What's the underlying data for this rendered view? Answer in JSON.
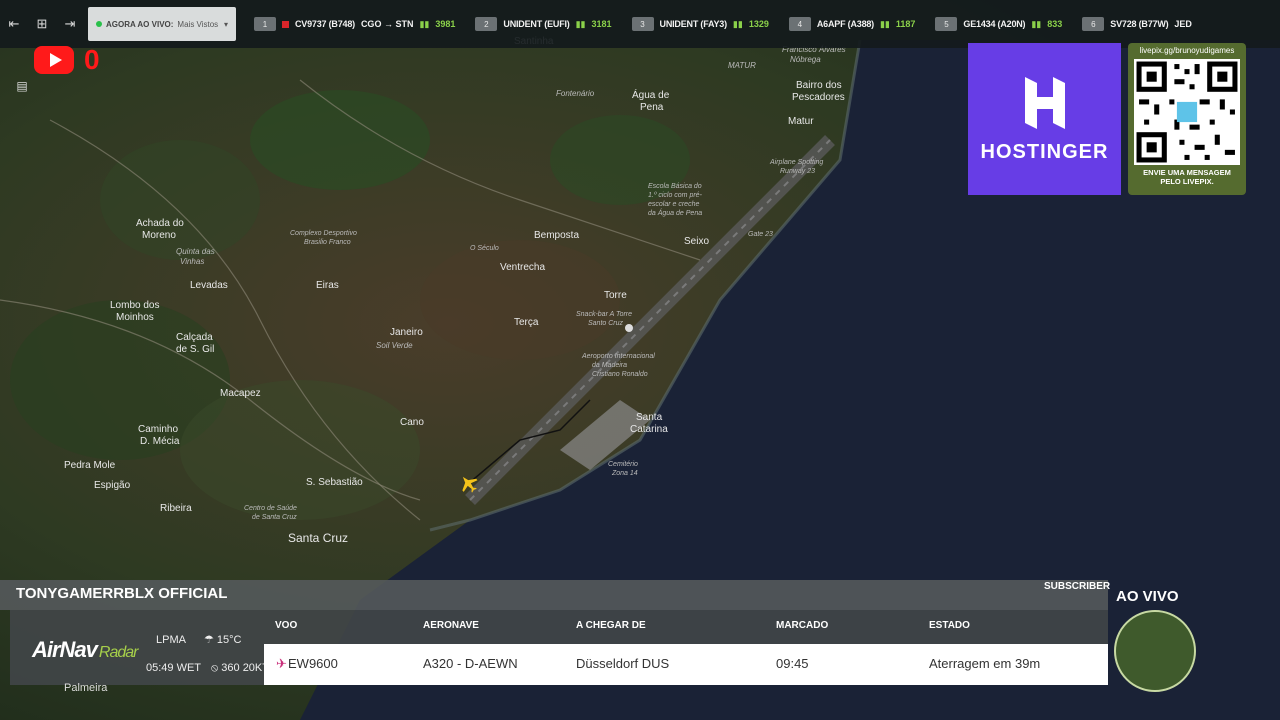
{
  "top_bar": {
    "live_label": "AGORA AO VIVO:",
    "live_option": "Mais Vistos",
    "flights": [
      {
        "num": "1",
        "callsign": "CV9737 (B748)",
        "route": "CGO → STN",
        "viewers": "3981"
      },
      {
        "num": "2",
        "callsign": "UNIDENT (EUFI)",
        "route": "",
        "viewers": "3181"
      },
      {
        "num": "3",
        "callsign": "UNIDENT (FAY3)",
        "route": "",
        "viewers": "1329"
      },
      {
        "num": "4",
        "callsign": "A6APF (A388)",
        "route": "",
        "viewers": "1187"
      },
      {
        "num": "5",
        "callsign": "GE1434 (A20N)",
        "route": "",
        "viewers": "833"
      },
      {
        "num": "6",
        "callsign": "SV728 (B77W)",
        "route": "JED",
        "viewers": ""
      }
    ]
  },
  "youtube": {
    "count": "0"
  },
  "sponsor": {
    "name": "HOSTINGER"
  },
  "livepix": {
    "url": "livepix.gg/brunoyudigames",
    "message_line1": "ENVIE UMA MENSAGEM",
    "message_line2": "PELO LIVEPIX."
  },
  "map_labels": [
    "Santinha",
    "Água de Pena",
    "Francisco Álvares Nóbrega",
    "Bairro dos Pescadores",
    "Matur",
    "MATUR",
    "Fontenário",
    "Achada do Moreno",
    "Quinta das Vinhas",
    "Levadas",
    "Lombo dos Moinhos",
    "Calçada de S. Gil",
    "Eiras",
    "Bemposta",
    "Ventrecha",
    "Seixo",
    "Torre",
    "Terça",
    "Janeiro",
    "Soil Verde",
    "Macapez",
    "Caminho D. Mécia",
    "Cano",
    "Santa Catarina",
    "Pedra Mole",
    "Espigão",
    "Ribeira",
    "S. Sebastião",
    "Santa Cruz",
    "Aeroporto Internacional da Madeira Cristiano Ronaldo",
    "Snack-bar A Torre Santo Cruz",
    "Escola Básica do 1.º ciclo com pré-escolar e creche da Água de Pena",
    "Airplane Spotting Runway 23",
    "Gate 23",
    "Cemitério Zona 14",
    "Complexo Desportivo Brasilio Franco",
    "O Século",
    "Centro de Saúde de Santa Cruz",
    "Palmeira"
  ],
  "bottom": {
    "channel_name": "TONYGAMERRBLX OFFICIAL",
    "subscriber_label": "SUBSCRIBER",
    "live_label": "AO VIVO",
    "airnav_brand": "AirNav",
    "airnav_sub": "Radar",
    "airport": "LPMA",
    "temperature": "15°C",
    "time": "05:49 WET",
    "wind": "360 20KT",
    "columns": {
      "flight": "VOO",
      "aircraft": "AERONAVE",
      "from": "A CHEGAR DE",
      "scheduled": "MARCADO",
      "status": "ESTADO"
    },
    "row": {
      "flight": "EW9600",
      "aircraft": "A320 - D-AEWN",
      "from": "Düsseldorf DUS",
      "scheduled": "09:45",
      "status": "Aterragem em 39m"
    }
  }
}
